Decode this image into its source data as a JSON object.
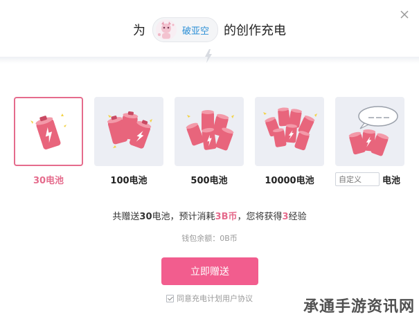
{
  "header": {
    "title_prefix": "为",
    "user_name": "破亚空",
    "title_suffix": "的创作充电"
  },
  "options": [
    {
      "label": "30电池",
      "selected": true
    },
    {
      "label": "100电池",
      "selected": false
    },
    {
      "label": "500电池",
      "selected": false
    },
    {
      "label": "10000电池",
      "selected": false
    }
  ],
  "custom": {
    "placeholder": "自定义",
    "unit": "电池"
  },
  "summary": {
    "part1": "共赠送",
    "batteries": "30",
    "part2": "电池，预计消耗",
    "cost": "3B币",
    "part3": "，您将获得",
    "exp": "3",
    "part4": "经验"
  },
  "balance": "钱包余额：0B币",
  "send_button": "立即赠送",
  "agreement": "同意充电计划用户协议",
  "watermark": "承通手游资讯网",
  "colors": {
    "accent": "#f25d8e",
    "selected_border": "#e56b8c",
    "card_bg": "#eceef4",
    "battery_red": "#e8657c",
    "link_blue": "#2b8fd6"
  },
  "icons": [
    "close-icon",
    "lightning-icon",
    "battery-icon",
    "speech-bubble-icon",
    "check-icon"
  ]
}
